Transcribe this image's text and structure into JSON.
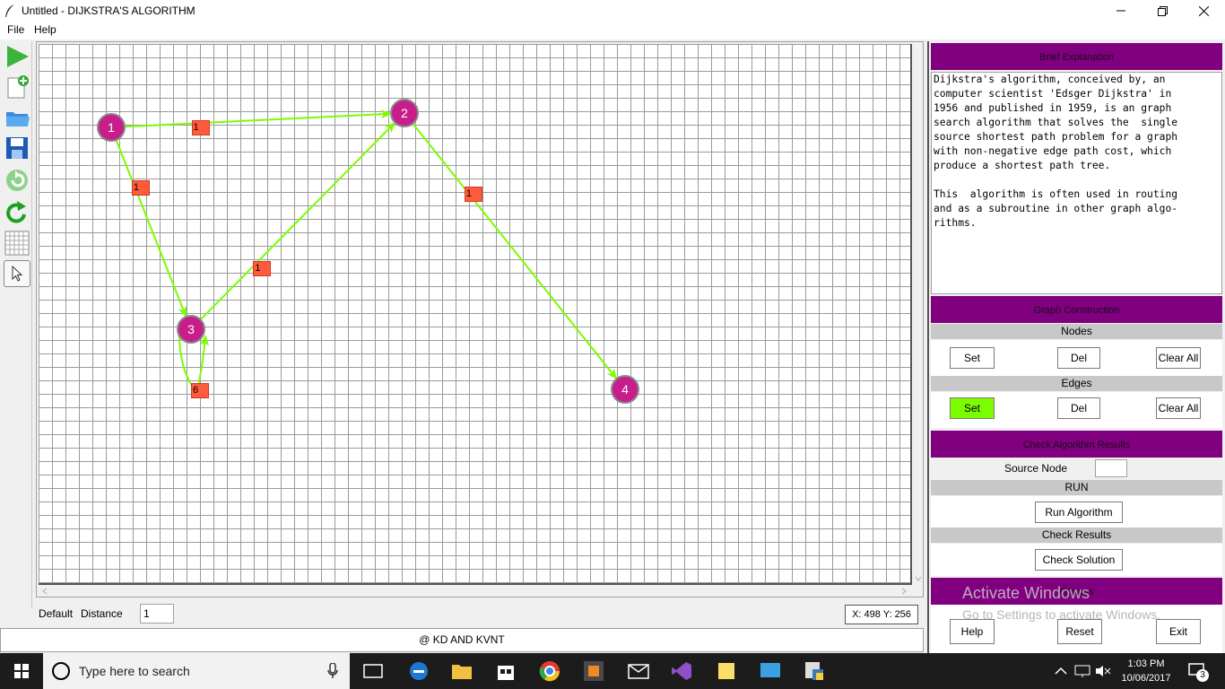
{
  "window": {
    "title": "Untitled - DIJKSTRA'S ALGORITHM"
  },
  "menu": [
    "File",
    "Help"
  ],
  "toolbar": [
    "run-icon",
    "new-graph-icon",
    "open-folder-icon",
    "save-icon",
    "undo-icon",
    "redo-icon",
    "grid-icon",
    "pointer-icon"
  ],
  "graph": {
    "nodes": [
      {
        "id": "1",
        "label": "1"
      },
      {
        "id": "2",
        "label": "2"
      },
      {
        "id": "3",
        "label": "3"
      },
      {
        "id": "4",
        "label": "4"
      }
    ],
    "edges": [
      {
        "from": "1",
        "to": "2",
        "weight": "1"
      },
      {
        "from": "1",
        "to": "3",
        "weight": "1"
      },
      {
        "from": "3",
        "to": "2",
        "weight": "1"
      },
      {
        "from": "2",
        "to": "4",
        "weight": "1"
      },
      {
        "from": "3",
        "to": "3",
        "weight": "6"
      }
    ],
    "colors": {
      "node": "#c81e8c",
      "edge": "#7cfc00",
      "weight_box": "#ff5a3c",
      "grid": "#9a9a9a"
    }
  },
  "status": {
    "default_label": "Default",
    "distance_label": "Distance",
    "distance_value": "1",
    "coords": "X: 498 Y: 256",
    "footer": "@ KD AND KVNT"
  },
  "panel": {
    "brief_title": "Brief Explanation",
    "explanation": "Dijkstra's algorithm, conceived by, an\ncomputer scientist 'Edsger Dijkstra' in\n1956 and published in 1959, is an graph\nsearch algorithm that solves the  single\nsource shortest path problem for a graph\nwith non-negative edge path cost, which\nproduce a shortest path tree.\n\nThis  algorithm is often used in routing\nand as a subroutine in other graph algo-\nrithms.",
    "construction_title": "Graph Construction",
    "nodes_label": "Nodes",
    "edges_label": "Edges",
    "set_label": "Set",
    "del_label": "Del",
    "clear_label": "Clear All",
    "check_title": "Check Algorithm Results",
    "source_label": "Source Node",
    "source_value": "",
    "run_label": "RUN",
    "run_button": "Run Algorithm",
    "check_label": "Check Results",
    "check_button": "Check Solution",
    "options_title": "Options",
    "help_button": "Help",
    "reset_button": "Reset",
    "exit_button": "Exit",
    "accent": "#800080",
    "active_button": "#7cfc00"
  },
  "watermark": {
    "line1": "Activate Windows",
    "line2": "Go to Settings to activate Windows."
  },
  "taskbar": {
    "search_placeholder": "Type here to search",
    "time": "1:03 PM",
    "date": "10/06/2017",
    "notification_count": "3"
  }
}
